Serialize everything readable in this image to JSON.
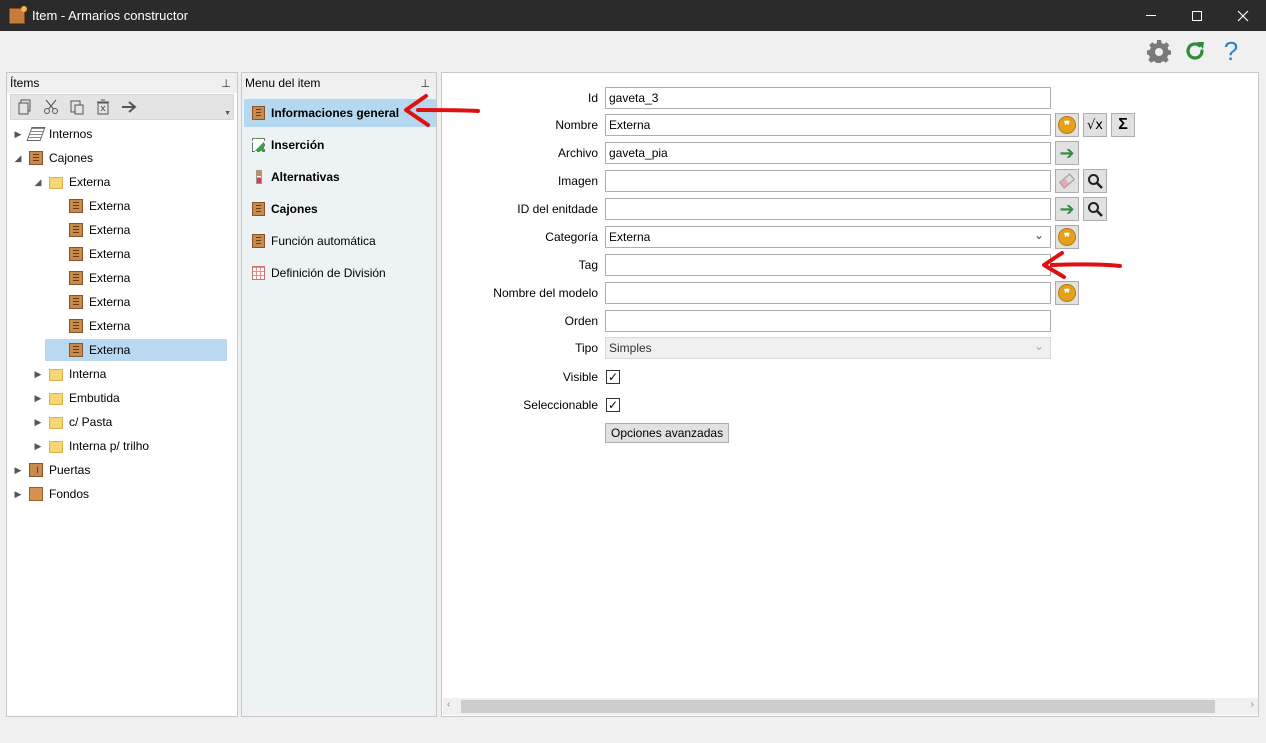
{
  "window": {
    "title": "Item - Armarios constructor"
  },
  "items_panel": {
    "header": "Ítems",
    "tree": [
      {
        "label": "Internos",
        "icon": "internos-icon",
        "expander": "▶",
        "level": 0
      },
      {
        "label": "Cajones",
        "icon": "cabinet-icon",
        "expander": "◢",
        "level": 0
      },
      {
        "label": "Externa",
        "icon": "folder-icon",
        "expander": "◢",
        "level": 1
      },
      {
        "label": "Externa",
        "icon": "cabinet-icon",
        "expander": "",
        "level": 2
      },
      {
        "label": "Externa",
        "icon": "cabinet-icon",
        "expander": "",
        "level": 2
      },
      {
        "label": "Externa",
        "icon": "cabinet-icon",
        "expander": "",
        "level": 2
      },
      {
        "label": "Externa",
        "icon": "cabinet-icon",
        "expander": "",
        "level": 2
      },
      {
        "label": "Externa",
        "icon": "cabinet-icon",
        "expander": "",
        "level": 2
      },
      {
        "label": "Externa",
        "icon": "cabinet-icon",
        "expander": "",
        "level": 2
      },
      {
        "label": "Externa",
        "icon": "cabinet-icon",
        "expander": "",
        "level": 2,
        "selected": true
      },
      {
        "label": "Interna",
        "icon": "folder-icon",
        "expander": "▶",
        "level": 1
      },
      {
        "label": "Embutida",
        "icon": "folder-icon",
        "expander": "▶",
        "level": 1
      },
      {
        "label": "c/ Pasta",
        "icon": "folder-icon",
        "expander": "▶",
        "level": 1
      },
      {
        "label": "Interna p/ trilho",
        "icon": "folder-icon",
        "expander": "▶",
        "level": 1
      },
      {
        "label": "Puertas",
        "icon": "door-icon",
        "expander": "▶",
        "level": 0
      },
      {
        "label": "Fondos",
        "icon": "back-panel-icon",
        "expander": "▶",
        "level": 0
      }
    ]
  },
  "menu_panel": {
    "header": "Menu del item",
    "items": [
      {
        "label": "Informaciones general",
        "icon": "cabinet-icon"
      },
      {
        "label": "Inserción",
        "icon": "insert-icon"
      },
      {
        "label": "Alternativas",
        "icon": "alternatives-icon"
      },
      {
        "label": "Cajones",
        "icon": "cabinet-icon"
      },
      {
        "label": "Función automática",
        "icon": "cabinet-icon"
      },
      {
        "label": "Definición de División",
        "icon": "grid-icon"
      }
    ]
  },
  "form": {
    "id": {
      "label": "Id",
      "value": "gaveta_3"
    },
    "nombre": {
      "label": "Nombre",
      "value": "Externa"
    },
    "archivo": {
      "label": "Archivo",
      "value": "gaveta_pia"
    },
    "imagen": {
      "label": "Imagen",
      "value": ""
    },
    "id_entidad": {
      "label": "ID del enitdade",
      "value": ""
    },
    "categoria": {
      "label": "Categoría",
      "value": "Externa"
    },
    "tag": {
      "label": "Tag",
      "value": ""
    },
    "nombre_modelo": {
      "label": "Nombre del modelo",
      "value": ""
    },
    "orden": {
      "label": "Orden",
      "value": ""
    },
    "tipo": {
      "label": "Tipo",
      "value": "Simples"
    },
    "visible": {
      "label": "Visible",
      "checked": true,
      "mark": "✓"
    },
    "seleccionable": {
      "label": "Seleccionable",
      "checked": true,
      "mark": "✓"
    },
    "advanced_button": "Opciones avanzadas"
  },
  "colors": {
    "titlebar": "#2b2b2b",
    "selection": "#b9d9f2",
    "menu_active": "#b4d8ef",
    "annotation_arrow": "#e01010"
  }
}
